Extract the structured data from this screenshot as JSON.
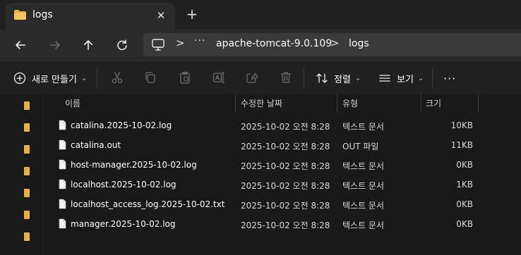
{
  "window": {
    "tab_title": "logs",
    "tab_close": "✕",
    "new_tab": "+"
  },
  "address": {
    "overflow": "···",
    "breadcrumbs": [
      "apache-tomcat-9.0.109",
      "logs"
    ],
    "separator": ">"
  },
  "commandbar": {
    "new_label": "새로 만들기",
    "sort_label": "정렬",
    "view_label": "보기",
    "more": "···"
  },
  "columns": [
    "이름",
    "수정한 날짜",
    "유형",
    "크기"
  ],
  "files": [
    {
      "name": "catalina.2025-10-02.log",
      "date": "2025-10-02 오전 8:28",
      "type": "텍스트 문서",
      "size": "10KB"
    },
    {
      "name": "catalina.out",
      "date": "2025-10-02 오전 8:28",
      "type": "OUT 파일",
      "size": "11KB"
    },
    {
      "name": "host-manager.2025-10-02.log",
      "date": "2025-10-02 오전 8:28",
      "type": "텍스트 문서",
      "size": "0KB"
    },
    {
      "name": "localhost.2025-10-02.log",
      "date": "2025-10-02 오전 8:28",
      "type": "텍스트 문서",
      "size": "1KB"
    },
    {
      "name": "localhost_access_log.2025-10-02.txt",
      "date": "2025-10-02 오전 8:28",
      "type": "텍스트 문서",
      "size": "0KB"
    },
    {
      "name": "manager.2025-10-02.log",
      "date": "2025-10-02 오전 8:28",
      "type": "텍스트 문서",
      "size": "0KB"
    }
  ],
  "colors": {
    "accent_folder": "#e8b23d",
    "background": "#191919",
    "toolbar": "#202020",
    "address_bar": "#3a3a3a"
  }
}
